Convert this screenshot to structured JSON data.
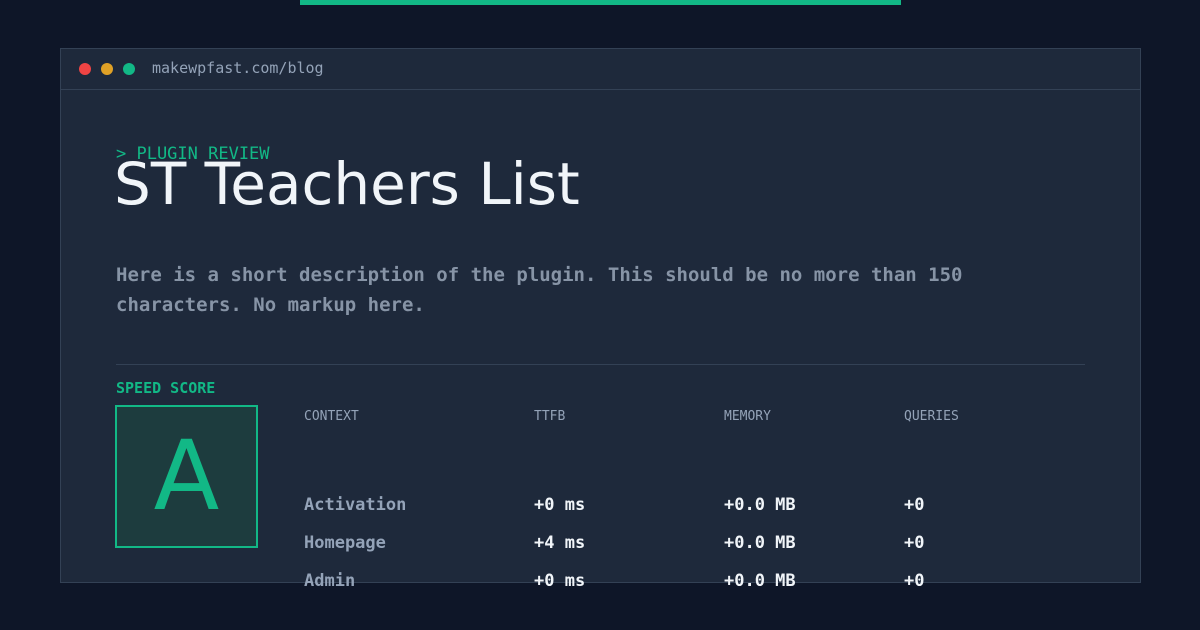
{
  "browser": {
    "url": "makewpfast.com/blog"
  },
  "hero": {
    "eyebrow": "> PLUGIN REVIEW",
    "title": "ST Teachers List",
    "description": "Here is a short description of the plugin. This should be no more than 150 characters. No markup here."
  },
  "score": {
    "label": "SPEED SCORE",
    "grade": "A"
  },
  "table": {
    "headers": [
      "CONTEXT",
      "TTFB",
      "MEMORY",
      "QUERIES"
    ],
    "rows": [
      {
        "context": "Activation",
        "ttfb": "+0 ms",
        "memory": "+0.0 MB",
        "queries": "+0"
      },
      {
        "context": "Homepage",
        "ttfb": "+4 ms",
        "memory": "+0.0 MB",
        "queries": "+0"
      },
      {
        "context": "Admin",
        "ttfb": "+0 ms",
        "memory": "+0.0 MB",
        "queries": "+0"
      }
    ]
  },
  "colors": {
    "accent": "#12b886",
    "background": "#0e1628",
    "panel": "#1e293b",
    "text": "#f1f5f9",
    "muted": "#94a3b8",
    "window_close": "#ef4444",
    "window_minimize": "#e0a126",
    "window_maximize": "#12b886"
  }
}
